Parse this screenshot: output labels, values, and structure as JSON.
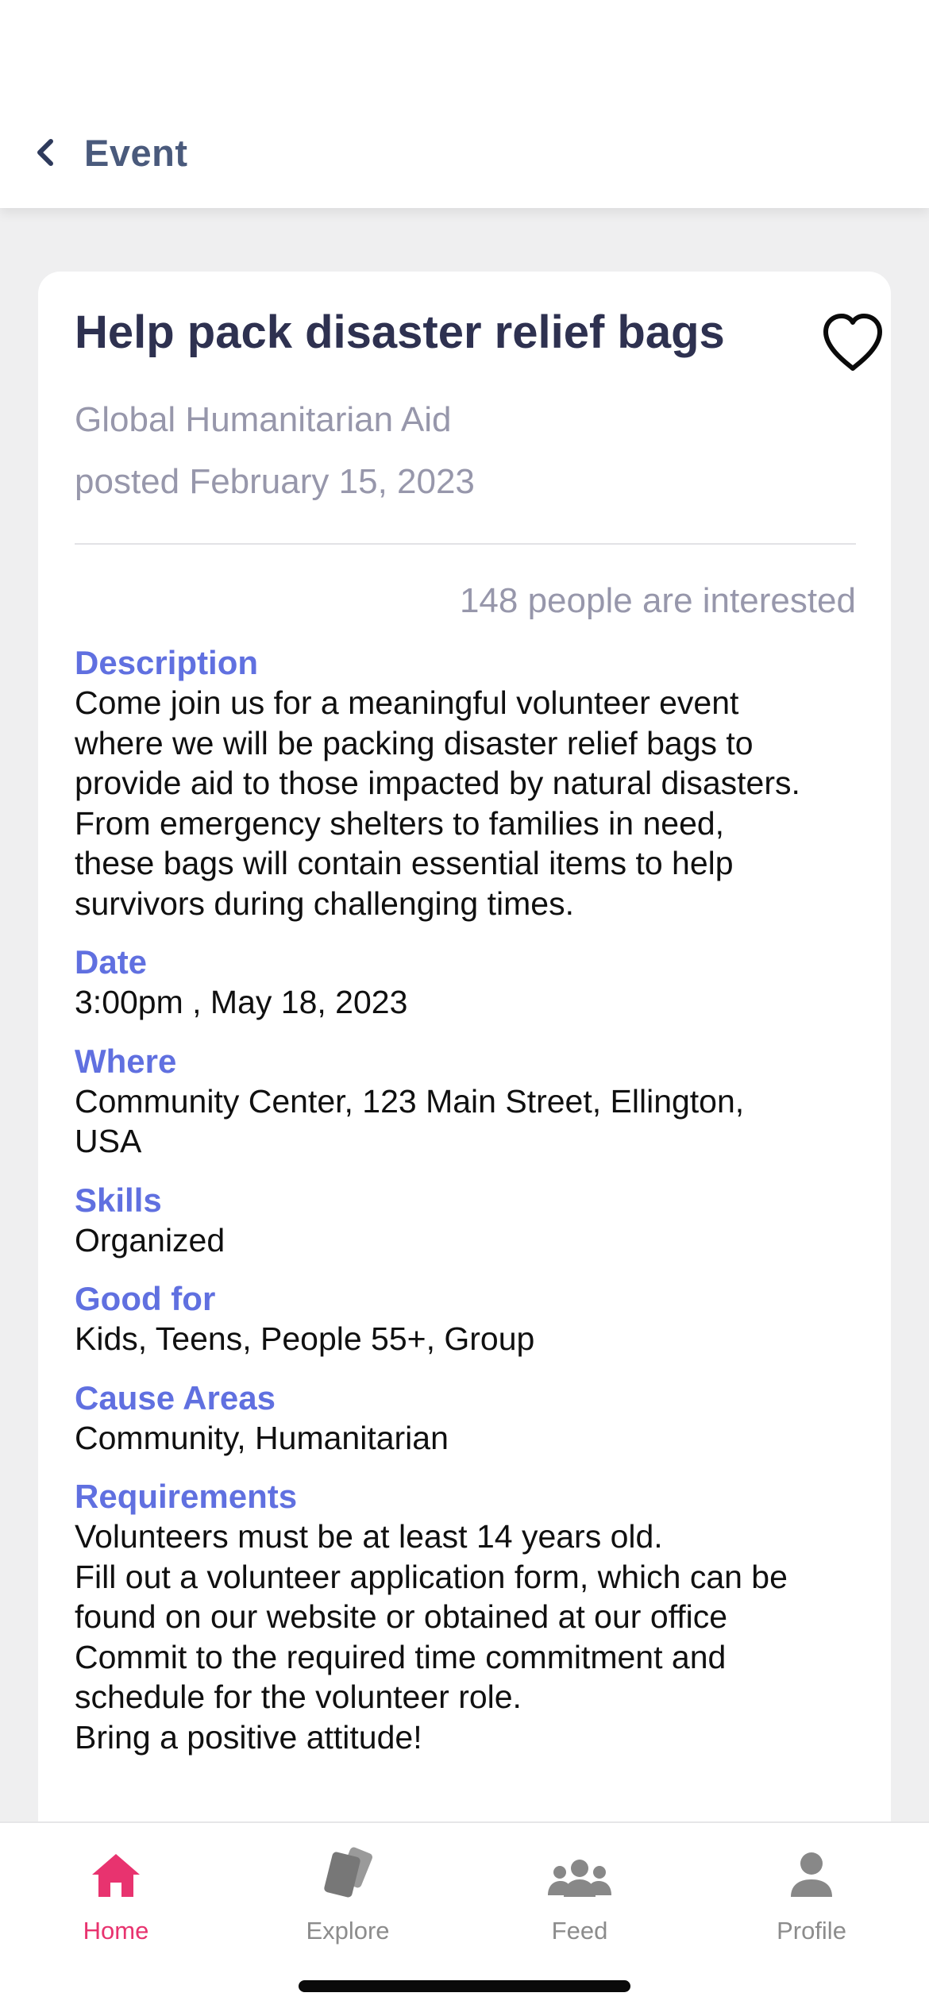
{
  "header": {
    "title": "Event",
    "back_icon": "chevron-left-icon"
  },
  "event": {
    "title": "Help pack disaster relief bags",
    "organization": "Global Humanitarian Aid",
    "posted": "posted February 15, 2023",
    "interested": "148 people are interested",
    "favorite_icon": "heart-outline-icon",
    "sections": {
      "description": {
        "label": "Description",
        "text": "Come join us for a meaningful volunteer event\nwhere we will be packing disaster relief bags to\nprovide aid to those impacted by natural disasters.\nFrom emergency shelters to families in need,\nthese bags will contain essential items to help\nsurvivors during challenging times."
      },
      "date": {
        "label": "Date",
        "text": "3:00pm , May 18, 2023"
      },
      "where": {
        "label": "Where",
        "text": "Community Center, 123 Main Street, Ellington,\nUSA"
      },
      "skills": {
        "label": "Skills",
        "text": "Organized"
      },
      "good_for": {
        "label": "Good for",
        "text": "Kids, Teens, People 55+, Group"
      },
      "cause_areas": {
        "label": "Cause Areas",
        "text": "Community, Humanitarian"
      },
      "requirements": {
        "label": "Requirements",
        "text": "Volunteers must be at least 14 years old.\nFill out a volunteer application form, which can be\nfound on our website or obtained at our office\nCommit to the required time commitment and\nschedule for the volunteer role.\nBring a positive attitude!"
      }
    }
  },
  "tabbar": {
    "tabs": [
      {
        "label": "Home",
        "icon": "home-icon",
        "active": true
      },
      {
        "label": "Explore",
        "icon": "cards-icon",
        "active": false
      },
      {
        "label": "Feed",
        "icon": "people-icon",
        "active": false
      },
      {
        "label": "Profile",
        "icon": "person-icon",
        "active": false
      }
    ]
  },
  "colors": {
    "accent": "#e8336f",
    "section_label": "#6070e0",
    "title": "#2e3150",
    "muted": "#9797ab",
    "header_title": "#4a5a7c",
    "background": "#efeff0"
  }
}
